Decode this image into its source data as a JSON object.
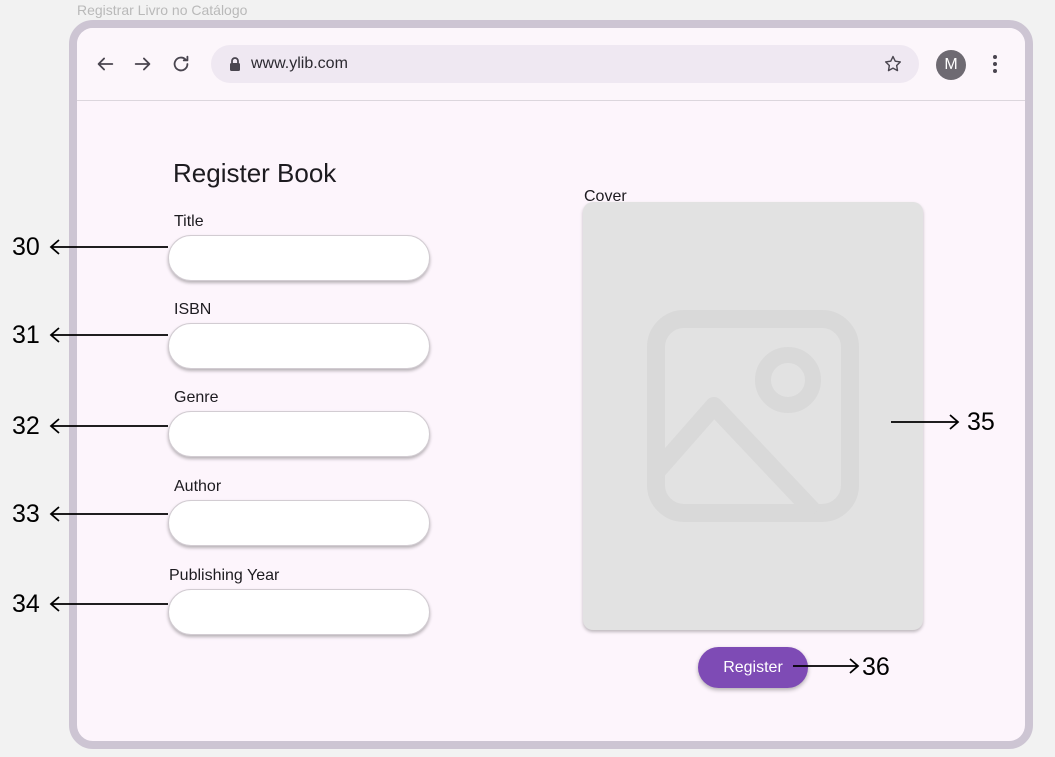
{
  "window_caption": "Registrar Livro no Catálogo",
  "browser": {
    "url": "www.ylib.com",
    "avatar_initial": "M",
    "icons": [
      "arrow-back-icon",
      "arrow-forward-icon",
      "reload-icon",
      "lock-icon",
      "star-icon",
      "more-vert-icon"
    ]
  },
  "form": {
    "title": "Register Book",
    "fields": [
      {
        "label": "Title",
        "value": "",
        "callout": "30"
      },
      {
        "label": "ISBN",
        "value": "",
        "callout": "31"
      },
      {
        "label": "Genre",
        "value": "",
        "callout": "32"
      },
      {
        "label": "Author",
        "value": "",
        "callout": "33"
      },
      {
        "label": "Publishing Year",
        "value": "",
        "callout": "34"
      }
    ],
    "cover_label": "Cover",
    "cover_callout": "35",
    "register_label": "Register",
    "register_callout": "36"
  },
  "colors": {
    "accent": "#7e4bb5",
    "page_background": "#fdf5fc",
    "frame": "#cdc5d3",
    "cover_placeholder": "#e2e2e2"
  }
}
